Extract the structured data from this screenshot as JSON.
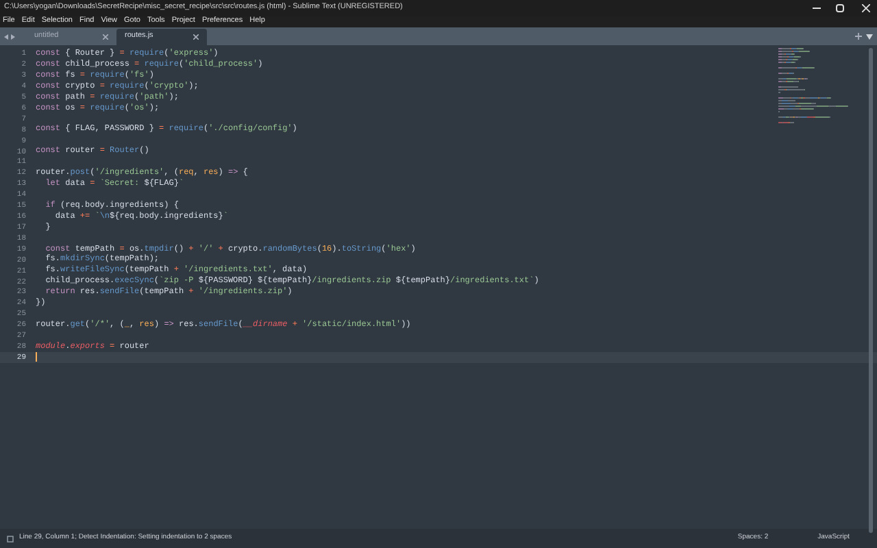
{
  "window": {
    "title": "C:\\Users\\yogan\\Downloads\\SecretRecipe\\misc_secret_recipe\\src\\src\\routes.js (html) - Sublime Text (UNREGISTERED)"
  },
  "menu": [
    "File",
    "Edit",
    "Selection",
    "Find",
    "View",
    "Goto",
    "Tools",
    "Project",
    "Preferences",
    "Help"
  ],
  "tabs": [
    {
      "label": "untitled",
      "selected": false
    },
    {
      "label": "routes.js",
      "selected": true
    }
  ],
  "lines": [
    {
      "num": "1",
      "current": false,
      "tokens": [
        {
          "kind": "kw",
          "text": "const"
        },
        {
          "kind": "plain",
          "text": " { Router } "
        },
        {
          "kind": "op",
          "text": "= "
        },
        {
          "kind": "fn",
          "text": "require"
        },
        {
          "kind": "plain",
          "text": "("
        },
        {
          "kind": "str",
          "text": "'express'"
        },
        {
          "kind": "plain",
          "text": ")"
        }
      ]
    },
    {
      "num": "2",
      "current": false,
      "tokens": [
        {
          "kind": "kw",
          "text": "const"
        },
        {
          "kind": "plain",
          "text": " child_process "
        },
        {
          "kind": "op",
          "text": "= "
        },
        {
          "kind": "fn",
          "text": "require"
        },
        {
          "kind": "plain",
          "text": "("
        },
        {
          "kind": "str",
          "text": "'child_process'"
        },
        {
          "kind": "plain",
          "text": ")"
        }
      ]
    },
    {
      "num": "3",
      "current": false,
      "tokens": [
        {
          "kind": "kw",
          "text": "const"
        },
        {
          "kind": "plain",
          "text": " fs "
        },
        {
          "kind": "op",
          "text": "= "
        },
        {
          "kind": "fn",
          "text": "require"
        },
        {
          "kind": "plain",
          "text": "("
        },
        {
          "kind": "str",
          "text": "'fs'"
        },
        {
          "kind": "plain",
          "text": ")"
        }
      ]
    },
    {
      "num": "4",
      "current": false,
      "tokens": [
        {
          "kind": "kw",
          "text": "const"
        },
        {
          "kind": "plain",
          "text": " crypto "
        },
        {
          "kind": "op",
          "text": "= "
        },
        {
          "kind": "fn",
          "text": "require"
        },
        {
          "kind": "plain",
          "text": "("
        },
        {
          "kind": "str",
          "text": "'crypto'"
        },
        {
          "kind": "plain",
          "text": ");"
        }
      ]
    },
    {
      "num": "5",
      "current": false,
      "tokens": [
        {
          "kind": "kw",
          "text": "const"
        },
        {
          "kind": "plain",
          "text": " path "
        },
        {
          "kind": "op",
          "text": "= "
        },
        {
          "kind": "fn",
          "text": "require"
        },
        {
          "kind": "plain",
          "text": "("
        },
        {
          "kind": "str",
          "text": "'path'"
        },
        {
          "kind": "plain",
          "text": ");"
        }
      ]
    },
    {
      "num": "6",
      "current": false,
      "tokens": [
        {
          "kind": "kw",
          "text": "const"
        },
        {
          "kind": "plain",
          "text": " os "
        },
        {
          "kind": "op",
          "text": "= "
        },
        {
          "kind": "fn",
          "text": "require"
        },
        {
          "kind": "plain",
          "text": "("
        },
        {
          "kind": "str",
          "text": "'os'"
        },
        {
          "kind": "plain",
          "text": ");"
        }
      ]
    },
    {
      "num": "7",
      "current": false
    },
    {
      "num": "8",
      "current": false,
      "tokens": [
        {
          "kind": "kw",
          "text": "const"
        },
        {
          "kind": "plain",
          "text": " { FLAG, PASSWORD } "
        },
        {
          "kind": "op",
          "text": "= "
        },
        {
          "kind": "fn",
          "text": "require"
        },
        {
          "kind": "plain",
          "text": "("
        },
        {
          "kind": "str",
          "text": "'./config/config'"
        },
        {
          "kind": "plain",
          "text": ")"
        }
      ]
    },
    {
      "num": "9",
      "current": false
    },
    {
      "num": "10",
      "current": false,
      "tokens": [
        {
          "kind": "kw",
          "text": "const"
        },
        {
          "kind": "plain",
          "text": " router "
        },
        {
          "kind": "op",
          "text": "= "
        },
        {
          "kind": "fn",
          "text": "Router"
        },
        {
          "kind": "plain",
          "text": "()"
        }
      ]
    },
    {
      "num": "11",
      "current": false
    },
    {
      "num": "12",
      "current": false,
      "tokens": [
        {
          "kind": "plain",
          "text": "router."
        },
        {
          "kind": "fn",
          "text": "post"
        },
        {
          "kind": "plain",
          "text": "("
        },
        {
          "kind": "str",
          "text": "'/ingredients'"
        },
        {
          "kind": "plain",
          "text": ", ("
        },
        {
          "kind": "param",
          "text": "req"
        },
        {
          "kind": "plain",
          "text": ", "
        },
        {
          "kind": "param",
          "text": "res"
        },
        {
          "kind": "plain",
          "text": ") "
        },
        {
          "kind": "kw",
          "text": "=>"
        },
        {
          "kind": "plain",
          "text": " {"
        }
      ]
    },
    {
      "num": "13",
      "current": false,
      "tokens": [
        {
          "kind": "kw",
          "text": "  let"
        },
        {
          "kind": "plain",
          "text": " data "
        },
        {
          "kind": "op",
          "text": "= "
        },
        {
          "kind": "str",
          "text": "`Secret: "
        },
        {
          "kind": "plain",
          "text": "${FLAG}"
        },
        {
          "kind": "str",
          "text": "`"
        }
      ]
    },
    {
      "num": "14",
      "current": false
    },
    {
      "num": "15",
      "current": false,
      "tokens": [
        {
          "kind": "kw",
          "text": "  if"
        },
        {
          "kind": "plain",
          "text": " (req.body.ingredients) {"
        }
      ]
    },
    {
      "num": "16",
      "current": false,
      "tokens": [
        {
          "kind": "plain",
          "text": "    data "
        },
        {
          "kind": "op",
          "text": "+= "
        },
        {
          "kind": "str",
          "text": "`"
        },
        {
          "kind": "fn",
          "text": "\\n"
        },
        {
          "kind": "plain",
          "text": "${req.body.ingredients}"
        },
        {
          "kind": "str",
          "text": "`"
        }
      ]
    },
    {
      "num": "17",
      "current": false,
      "tokens": [
        {
          "kind": "plain",
          "text": "  }"
        }
      ]
    },
    {
      "num": "18",
      "current": false
    },
    {
      "num": "19",
      "current": false,
      "tokens": [
        {
          "kind": "kw",
          "text": "  const"
        },
        {
          "kind": "plain",
          "text": " tempPath "
        },
        {
          "kind": "op",
          "text": "="
        },
        {
          "kind": "plain",
          "text": " os."
        },
        {
          "kind": "fn",
          "text": "tmpdir"
        },
        {
          "kind": "plain",
          "text": "() "
        },
        {
          "kind": "op",
          "text": "+ "
        },
        {
          "kind": "str",
          "text": "'/'"
        },
        {
          "kind": "op",
          "text": " + "
        },
        {
          "kind": "plain",
          "text": "crypto."
        },
        {
          "kind": "fn",
          "text": "randomBytes"
        },
        {
          "kind": "plain",
          "text": "("
        },
        {
          "kind": "num",
          "text": "16"
        },
        {
          "kind": "plain",
          "text": ")."
        },
        {
          "kind": "fn",
          "text": "toString"
        },
        {
          "kind": "plain",
          "text": "("
        },
        {
          "kind": "str",
          "text": "'hex'"
        },
        {
          "kind": "plain",
          "text": ")"
        }
      ]
    },
    {
      "num": "20",
      "current": false,
      "tokens": [
        {
          "kind": "plain",
          "text": "  fs."
        },
        {
          "kind": "fn",
          "text": "mkdirSync"
        },
        {
          "kind": "plain",
          "text": "(tempPath);"
        }
      ]
    },
    {
      "num": "21",
      "current": false,
      "tokens": [
        {
          "kind": "plain",
          "text": "  fs."
        },
        {
          "kind": "fn",
          "text": "writeFileSync"
        },
        {
          "kind": "plain",
          "text": "(tempPath "
        },
        {
          "kind": "op",
          "text": "+ "
        },
        {
          "kind": "str",
          "text": "'/ingredients.txt'"
        },
        {
          "kind": "plain",
          "text": ", data)"
        }
      ]
    },
    {
      "num": "22",
      "current": false,
      "tokens": [
        {
          "kind": "plain",
          "text": "  child_process."
        },
        {
          "kind": "fn",
          "text": "execSync"
        },
        {
          "kind": "plain",
          "text": "("
        },
        {
          "kind": "str",
          "text": "`zip -P "
        },
        {
          "kind": "plain",
          "text": "${PASSWORD} ${tempPath}"
        },
        {
          "kind": "str",
          "text": "/ingredients.zip "
        },
        {
          "kind": "plain",
          "text": "${tempPath}"
        },
        {
          "kind": "str",
          "text": "/ingredients.txt`"
        },
        {
          "kind": "plain",
          "text": ")"
        }
      ]
    },
    {
      "num": "23",
      "current": false,
      "tokens": [
        {
          "kind": "kw",
          "text": "  return"
        },
        {
          "kind": "plain",
          "text": " res."
        },
        {
          "kind": "fn",
          "text": "sendFile"
        },
        {
          "kind": "plain",
          "text": "(tempPath "
        },
        {
          "kind": "op",
          "text": "+ "
        },
        {
          "kind": "str",
          "text": "'/ingredients.zip'"
        },
        {
          "kind": "plain",
          "text": ")"
        }
      ]
    },
    {
      "num": "24",
      "current": false,
      "tokens": [
        {
          "kind": "plain",
          "text": "})"
        }
      ]
    },
    {
      "num": "25",
      "current": false
    },
    {
      "num": "26",
      "current": false,
      "tokens": [
        {
          "kind": "plain",
          "text": "router."
        },
        {
          "kind": "fn",
          "text": "get"
        },
        {
          "kind": "plain",
          "text": "("
        },
        {
          "kind": "str",
          "text": "'/*'"
        },
        {
          "kind": "plain",
          "text": ", ("
        },
        {
          "kind": "param",
          "text": "_"
        },
        {
          "kind": "plain",
          "text": ", "
        },
        {
          "kind": "param",
          "text": "res"
        },
        {
          "kind": "plain",
          "text": ") "
        },
        {
          "kind": "kw",
          "text": "=>"
        },
        {
          "kind": "plain",
          "text": " res."
        },
        {
          "kind": "fn",
          "text": "sendFile"
        },
        {
          "kind": "plain",
          "text": "("
        },
        {
          "kind": "lang",
          "text": "__dirname"
        },
        {
          "kind": "op",
          "text": " + "
        },
        {
          "kind": "str",
          "text": "'/static/index.html'"
        },
        {
          "kind": "plain",
          "text": "))"
        }
      ]
    },
    {
      "num": "27",
      "current": false
    },
    {
      "num": "28",
      "current": false,
      "tokens": [
        {
          "kind": "lang",
          "text": "module"
        },
        {
          "kind": "plain",
          "text": "."
        },
        {
          "kind": "lang",
          "text": "exports"
        },
        {
          "kind": "op",
          "text": " = "
        },
        {
          "kind": "plain",
          "text": "router"
        }
      ]
    },
    {
      "num": "29",
      "current": true
    }
  ],
  "status_bar": {
    "message": "Line 29, Column 1; Detect Indentation: Setting indentation to 2 spaces",
    "indentation": "Spaces: 2",
    "syntax": "JavaScript"
  }
}
